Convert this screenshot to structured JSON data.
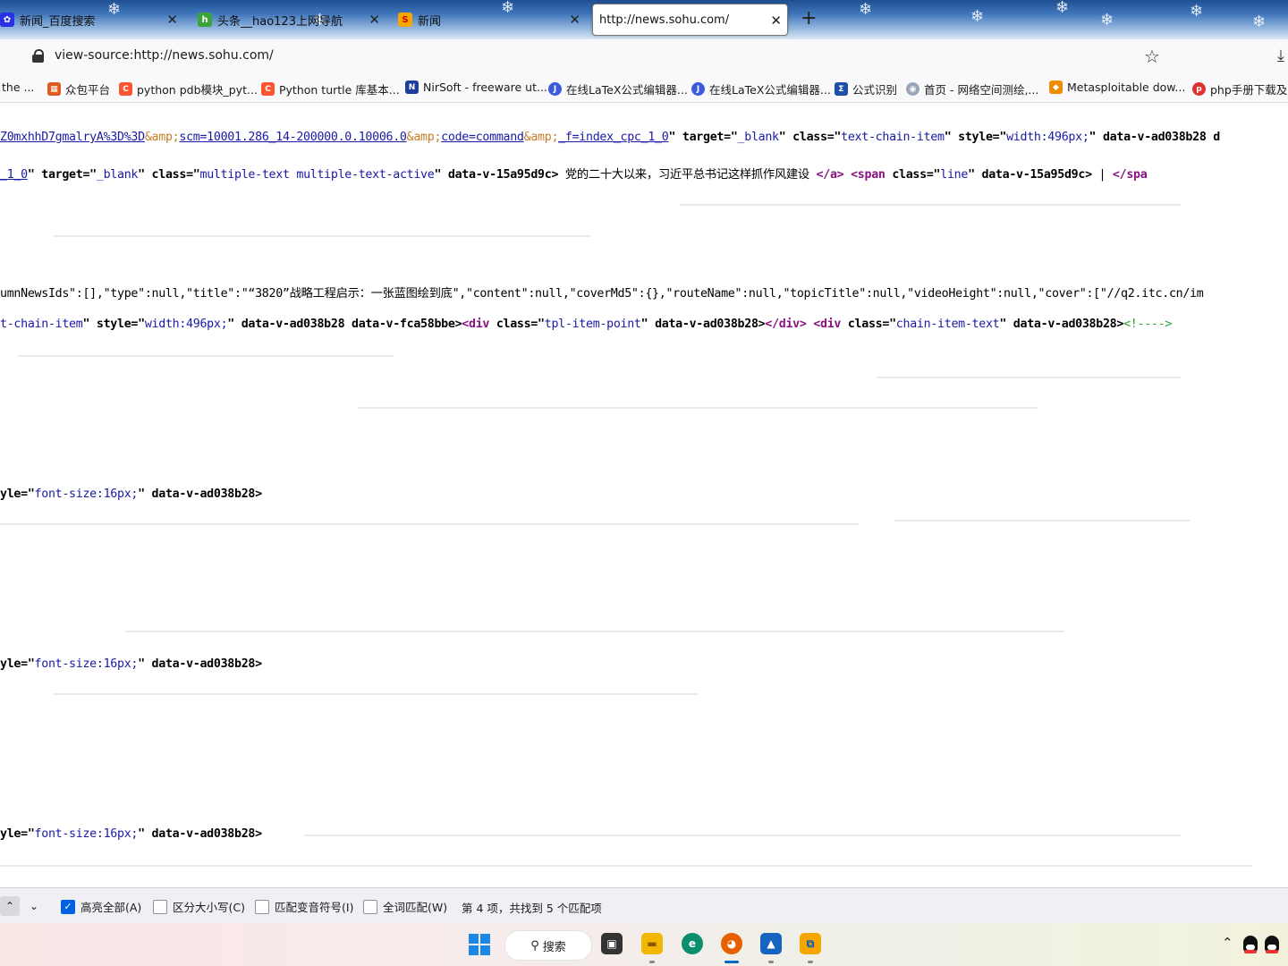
{
  "browser": {
    "tabs": [
      {
        "title": "新闻_百度搜索",
        "icon": "baidu-paw-icon",
        "color": "#2932e1",
        "active": false
      },
      {
        "title": "头条__hao123上网导航",
        "icon": "hao123-icon",
        "color": "#3aa33a",
        "active": false
      },
      {
        "title": "新闻",
        "icon": "sohu-icon",
        "color": "#f5a700",
        "active": false
      },
      {
        "title": "http://news.sohu.com/",
        "icon": "",
        "color": "",
        "active": true
      }
    ],
    "new_tab_glyph": "+",
    "close_glyph": "✕",
    "url": "view-source:http://news.sohu.com/",
    "bookmarks": [
      {
        "label": "the ...",
        "icon": ""
      },
      {
        "label": "众包平台",
        "icon": "grid-icon",
        "color": "#e05a1f"
      },
      {
        "label": "python pdb模块_pyt...",
        "icon": "csdn-icon",
        "color": "#fc5531"
      },
      {
        "label": "Python turtle 库基本...",
        "icon": "csdn-icon",
        "color": "#fc5531"
      },
      {
        "label": "NirSoft - freeware ut...",
        "icon": "nirsoft-icon",
        "color": "#1c3f9e"
      },
      {
        "label": "在线LaTeX公式编辑器...",
        "icon": "latex-icon",
        "color": "#3b5bdb"
      },
      {
        "label": "在线LaTeX公式编辑器...",
        "icon": "latex-icon",
        "color": "#3b5bdb"
      },
      {
        "label": "公式识别",
        "icon": "formula-icon",
        "color": "#1d4ea8"
      },
      {
        "label": "首页 - 网络空间测绘,...",
        "icon": "eye-icon",
        "color": "#9aa6b8"
      },
      {
        "label": "Metasploitable dow...",
        "icon": "diamond-icon",
        "color": "#f08c00"
      },
      {
        "label": "php手册下载及i",
        "icon": "php-icon",
        "color": "#e03131"
      }
    ]
  },
  "source": {
    "line1": {
      "link": "Z0mxhhD7gmalryA%3D%3D",
      "ent1": "&amp;",
      "link2": "scm=10001.286_14-200000.0.10006.0",
      "ent2": "&amp;",
      "link3": "code=command",
      "ent3": "&amp;",
      "link4": "_f=index_cpc_1_0",
      "rest_a": "\" target=\"",
      "v_blank": "_blank",
      "rest_b": "\" class=\"",
      "v_class": "text-chain-item",
      "rest_c": "\" style=\"",
      "v_style": "width:496px;",
      "rest_d": "\" data-v-ad038b28 d"
    },
    "line2": {
      "link": "_1_0",
      "a1": "\" target=\"",
      "v1": "_blank",
      "a2": "\" class=\"",
      "v2": "multiple-text multiple-text-active",
      "a3": "\" data-v-15a95d9c>",
      "text": " 党的二十大以来，习近平总书记这样抓作风建设 ",
      "close_a": "</a>",
      "sp": " ",
      "open_span": "<span",
      "a4": " class=\"",
      "v4": "line",
      "a5": "\" data-v-15a95d9c>",
      "text2": " | ",
      "close_span": "</spa"
    },
    "line3": "umnNewsIds\":[],\"type\":null,\"title\":\"“3820”战略工程启示：一张蓝图绘到底\",\"content\":null,\"coverMd5\":{},\"routeName\":null,\"topicTitle\":null,\"videoHeight\":null,\"cover\":[\"//q2.itc.cn/im",
    "line4": {
      "v0": "t-chain-item",
      "a1": "\" style=\"",
      "v1": "width:496px;",
      "a2": "\" data-v-ad038b28 data-v-fca58bbe>",
      "t1": "<div",
      "a3": " class=\"",
      "v3": "tpl-item-point",
      "a4": "\" data-v-ad038b28>",
      "t2": "</div>",
      "sp": " ",
      "t3": "<div",
      "a5": " class=\"",
      "v5": "chain-item-text",
      "a6": "\" data-v-ad038b28>",
      "cmt": "<!---->"
    },
    "style_line": {
      "a1": "yle=\"",
      "v1": "font-size:16px;",
      "a2": "\" data-v-ad038b28>"
    }
  },
  "findbar": {
    "up_glyph": "⌃",
    "down_glyph": "⌄",
    "highlight_all": "高亮全部(A)",
    "match_case": "区分大小写(C)",
    "match_diacritics": "匹配变音符号(I)",
    "whole_words": "全词匹配(W)",
    "status": "第 4 项，共找到 5 个匹配项",
    "highlight_all_checked": true,
    "match_case_checked": false,
    "match_diacritics_checked": false,
    "whole_words_checked": false
  },
  "taskbar": {
    "search_label": "搜索",
    "search_glyph": "⚲",
    "tray_chevron": "⌃"
  }
}
